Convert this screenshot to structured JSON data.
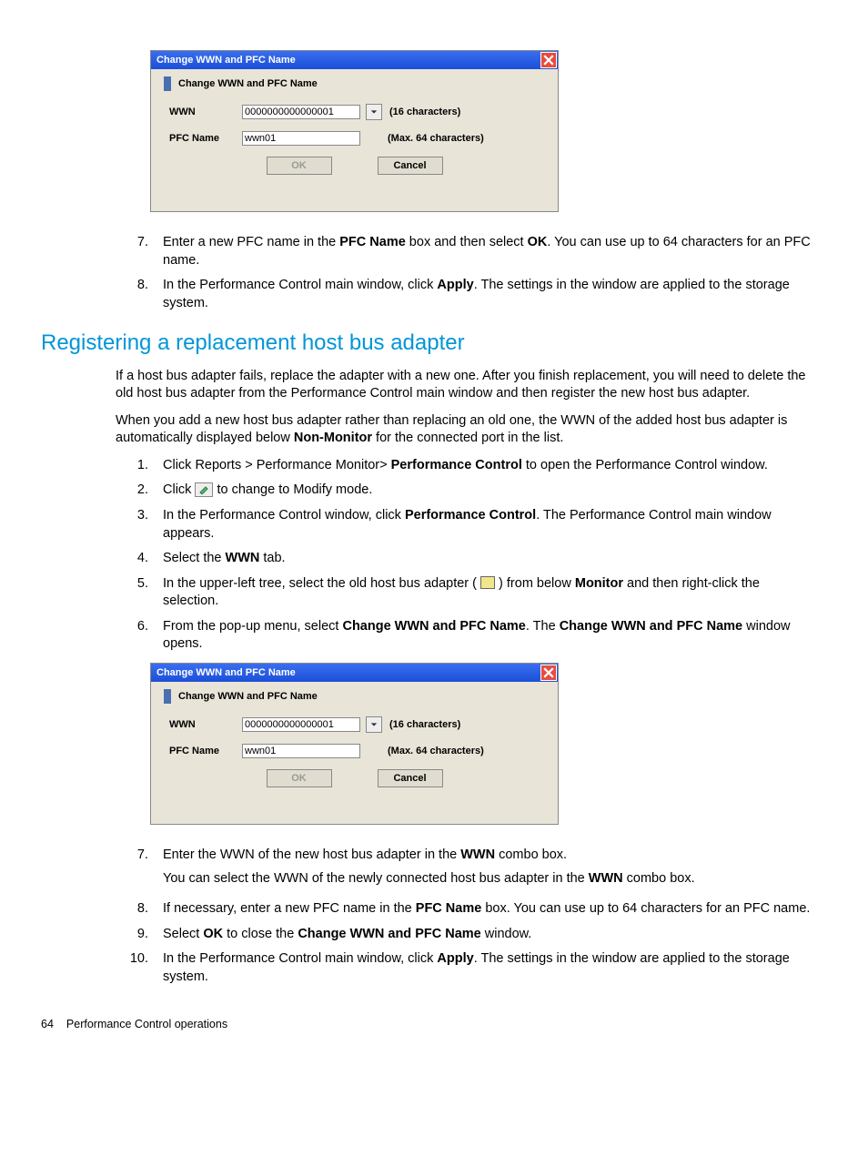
{
  "dialog": {
    "titlebar": "Change WWN and PFC Name",
    "header": "Change WWN and PFC Name",
    "wwn_label": "WWN",
    "wwn_value": "0000000000000001",
    "wwn_hint": "(16 characters)",
    "pfc_label": "PFC Name",
    "pfc_value": "wwn01",
    "pfc_hint": "(Max. 64 characters)",
    "ok": "OK",
    "cancel": "Cancel"
  },
  "listA": {
    "s7": {
      "num": "7.",
      "t1": "Enter a new PFC name in the ",
      "b1": "PFC Name",
      "t2": " box and then select ",
      "b2": "OK",
      "t3": ". You can use up to 64 characters for an PFC name."
    },
    "s8": {
      "num": "8.",
      "t1": "In the Performance Control main window, click ",
      "b1": "Apply",
      "t2": ". The settings in the window are applied to the storage system."
    }
  },
  "section_title": "Registering a replacement host bus adapter",
  "paraA": "If a host bus adapter fails, replace the adapter with a new one. After you finish replacement, you will need to delete the old host bus adapter from the Performance Control main window and then register the new host bus adapter.",
  "paraB": {
    "t1": "When you add a new host bus adapter rather than replacing an old one, the WWN of the added host bus adapter is automatically displayed below ",
    "b1": "Non-Monitor",
    "t2": " for the connected port in the list."
  },
  "listB": {
    "s1": {
      "num": "1.",
      "t1": "Click Reports > Performance Monitor> ",
      "b1": "Performance Control",
      "t2": " to open the Performance Control window."
    },
    "s2": {
      "num": "2.",
      "t1": "Click ",
      "t2": " to change to Modify mode."
    },
    "s3": {
      "num": "3.",
      "t1": "In the Performance Control window, click ",
      "b1": "Performance Control",
      "t2": ". The Performance Control main window appears."
    },
    "s4": {
      "num": "4.",
      "t1": "Select the ",
      "b1": "WWN",
      "t2": " tab."
    },
    "s5": {
      "num": "5.",
      "t1": "In the upper-left tree, select the old host bus adapter ( ",
      "t2": " ) from below ",
      "b1": "Monitor",
      "t3": " and then right-click the selection."
    },
    "s6": {
      "num": "6.",
      "t1": "From the pop-up menu, select ",
      "b1": "Change WWN and PFC Name",
      "t2": ". The ",
      "b2": "Change WWN and PFC Name",
      "t3": " window opens."
    },
    "s7": {
      "num": "7.",
      "p1t1": "Enter the WWN of the new host bus adapter in the ",
      "p1b1": "WWN",
      "p1t2": " combo box.",
      "p2t1": "You can select the WWN of the newly connected host bus adapter in the ",
      "p2b1": "WWN",
      "p2t2": " combo box."
    },
    "s8": {
      "num": "8.",
      "t1": "If necessary, enter a new PFC name in the ",
      "b1": "PFC Name",
      "t2": " box. You can use up to 64 characters for an PFC name."
    },
    "s9": {
      "num": "9.",
      "t1": "Select ",
      "b1": "OK",
      "t2": " to close the ",
      "b2": "Change WWN and PFC Name",
      "t3": " window."
    },
    "s10": {
      "num": "10.",
      "t1": "In the Performance Control main window, click ",
      "b1": "Apply",
      "t2": ". The settings in the window are applied to the storage system."
    }
  },
  "footer": {
    "page": "64",
    "section": "Performance Control operations"
  }
}
